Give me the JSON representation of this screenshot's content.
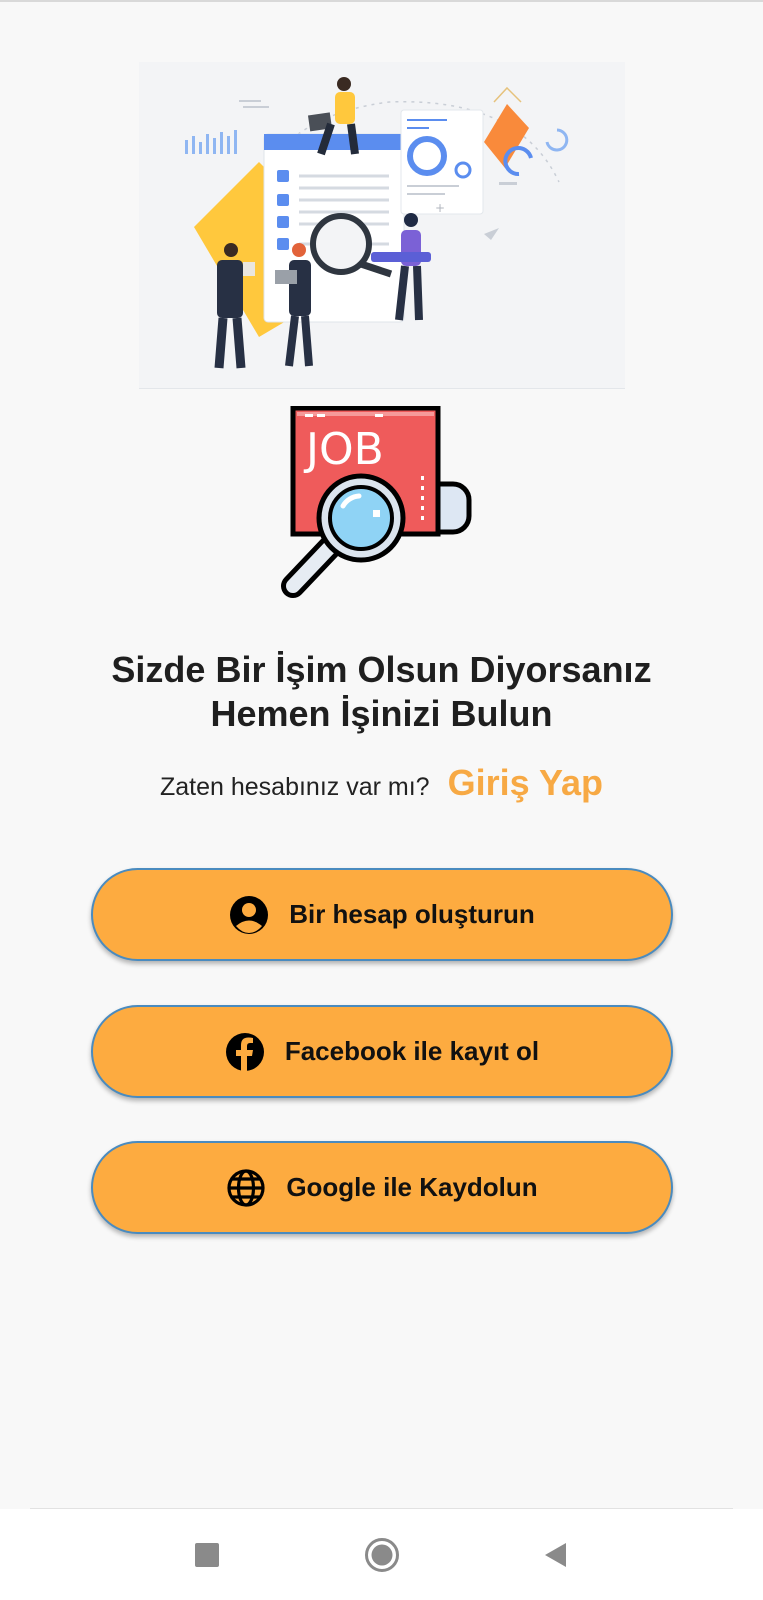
{
  "headline": {
    "line1": "Sizde Bir İşim Olsun Diyorsanız",
    "line2": "Hemen İşinizi Bulun"
  },
  "login": {
    "question": "Zaten hesabınız var mı?",
    "link": "Giriş Yap"
  },
  "logo": {
    "text": "JOB"
  },
  "buttons": [
    {
      "label": "Bir hesap oluşturun",
      "icon": "account-circle-icon"
    },
    {
      "label": "Facebook ile kayıt ol",
      "icon": "facebook-icon"
    },
    {
      "label": "Google ile Kaydolun",
      "icon": "globe-icon"
    }
  ],
  "navbar": {
    "icons": [
      "recents-square-icon",
      "home-circle-icon",
      "back-triangle-icon"
    ]
  },
  "colors": {
    "accent": "#fdab40",
    "link": "#f7a944",
    "button_border": "#4a8bbf",
    "background": "#f8f8f8"
  }
}
